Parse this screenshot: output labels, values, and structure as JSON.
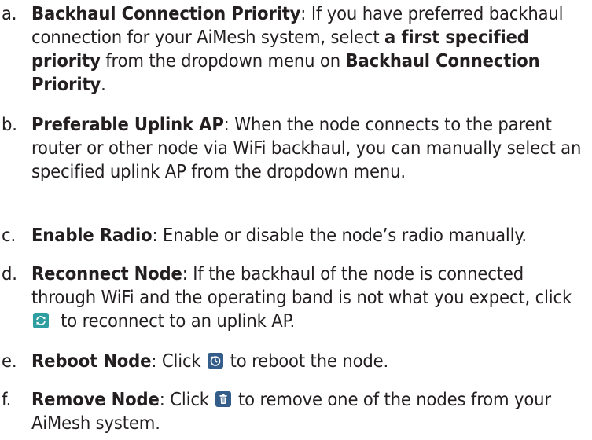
{
  "items": [
    {
      "marker": "a.",
      "term": "Backhaul Connection Priority",
      "sep": ": ",
      "t1": "If you have preferred backhaul connection for your AiMesh system, select ",
      "b1": "a first specified priority",
      "t2": " from the dropdown menu on ",
      "b2": "Backhaul Connection Priority",
      "t3": "."
    },
    {
      "marker": "b.",
      "term": "Preferable Uplink AP",
      "sep": ": ",
      "t1": "When the node connects to the parent router or other node via WiFi backhaul, you can manually select an specified uplink AP from the dropdown menu."
    },
    {
      "marker": "c.",
      "term": "Enable Radio",
      "sep": ": ",
      "t1": "Enable or disable the node’s radio manually."
    },
    {
      "marker": "d.",
      "term": "Reconnect Node",
      "sep": ": ",
      "t1": "If the backhaul of the node is connected through WiFi and the operating band is not what you expect, click ",
      "icon": "reconnect-icon",
      "t2": "  to reconnect to an uplink AP."
    },
    {
      "marker": "e.",
      "term": "Reboot Node",
      "sep": ": ",
      "t1": "Click ",
      "icon": "reboot-icon",
      "t2": " to reboot the node."
    },
    {
      "marker": "f.",
      "term": "Remove Node",
      "sep": ": ",
      "t1": "Click ",
      "icon": "trash-icon",
      "t2": " to remove one of the nodes from your AiMesh system."
    }
  ],
  "colors": {
    "text": "#231f20",
    "reconnect_icon": "#2f9ea0",
    "reboot_icon": "#355d8a",
    "trash_icon": "#355d8a"
  }
}
